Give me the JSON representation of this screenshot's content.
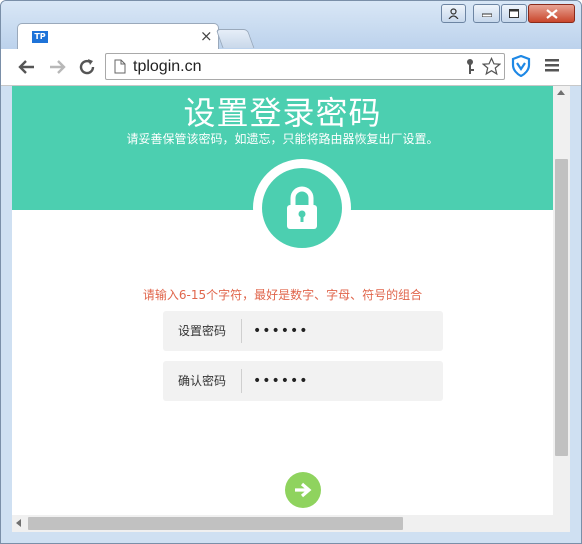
{
  "browser": {
    "tab": {
      "favicon_text": "TP",
      "title": "",
      "close_glyph": "×"
    },
    "address_bar": {
      "url": "tplogin.cn"
    },
    "icons": {
      "back": "back-arrow-icon",
      "forward": "forward-arrow-icon",
      "reload": "reload-icon",
      "page": "page-icon",
      "key": "key-icon",
      "bookmark": "star-icon",
      "extension": "shield-extension-icon",
      "menu": "hamburger-menu-icon"
    }
  },
  "page": {
    "title": "设置登录密码",
    "subtitle": "请妥善保管该密码，如遗忘，只能将路由器恢复出厂设置。",
    "hint": "请输入6-15个字符，最好是数字、字母、符号的组合",
    "fields": [
      {
        "label": "设置密码",
        "value": "••••••"
      },
      {
        "label": "确认密码",
        "value": "••••••"
      }
    ],
    "colors": {
      "accent": "#4ccfb0",
      "hint": "#e0664c",
      "button": "#8fd35e"
    }
  }
}
